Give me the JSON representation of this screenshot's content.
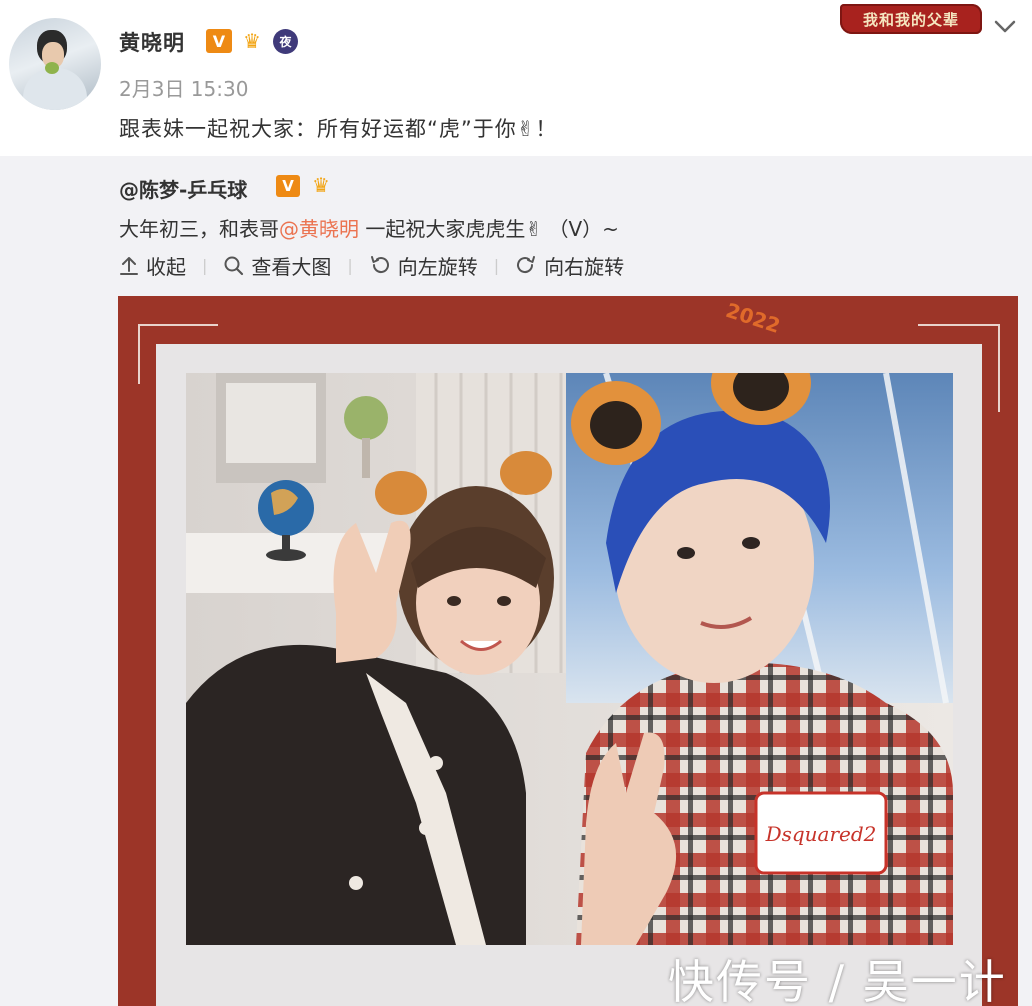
{
  "post": {
    "username": "黄晓明",
    "badge_v": "V",
    "badge_night": "夜",
    "timestamp": "2月3日 15:30",
    "text": "跟表妹一起祝大家：所有好运都“虎”于你✌！",
    "stamp_text": "我和我的父辈"
  },
  "repost": {
    "username": "@陈梦-乒乓球",
    "badge_v": "V",
    "text_before": "大年初三，和表哥",
    "mention": "@黄晓明",
    "text_after": " 一起祝大家虎虎生✌ （V）~"
  },
  "actions": {
    "collapse": "收起",
    "view_large": "查看大图",
    "rotate_left": "向左旋转",
    "rotate_right": "向右旋转"
  },
  "photo": {
    "year_label": "2022",
    "shirt_patch": "Dsquared2"
  },
  "watermark": "快传号 / 吴一计",
  "colors": {
    "frame_red": "#9c3528",
    "mention": "#eb7350",
    "verified_orange": "#ee8a14",
    "repost_bg": "#f2f2f5"
  }
}
